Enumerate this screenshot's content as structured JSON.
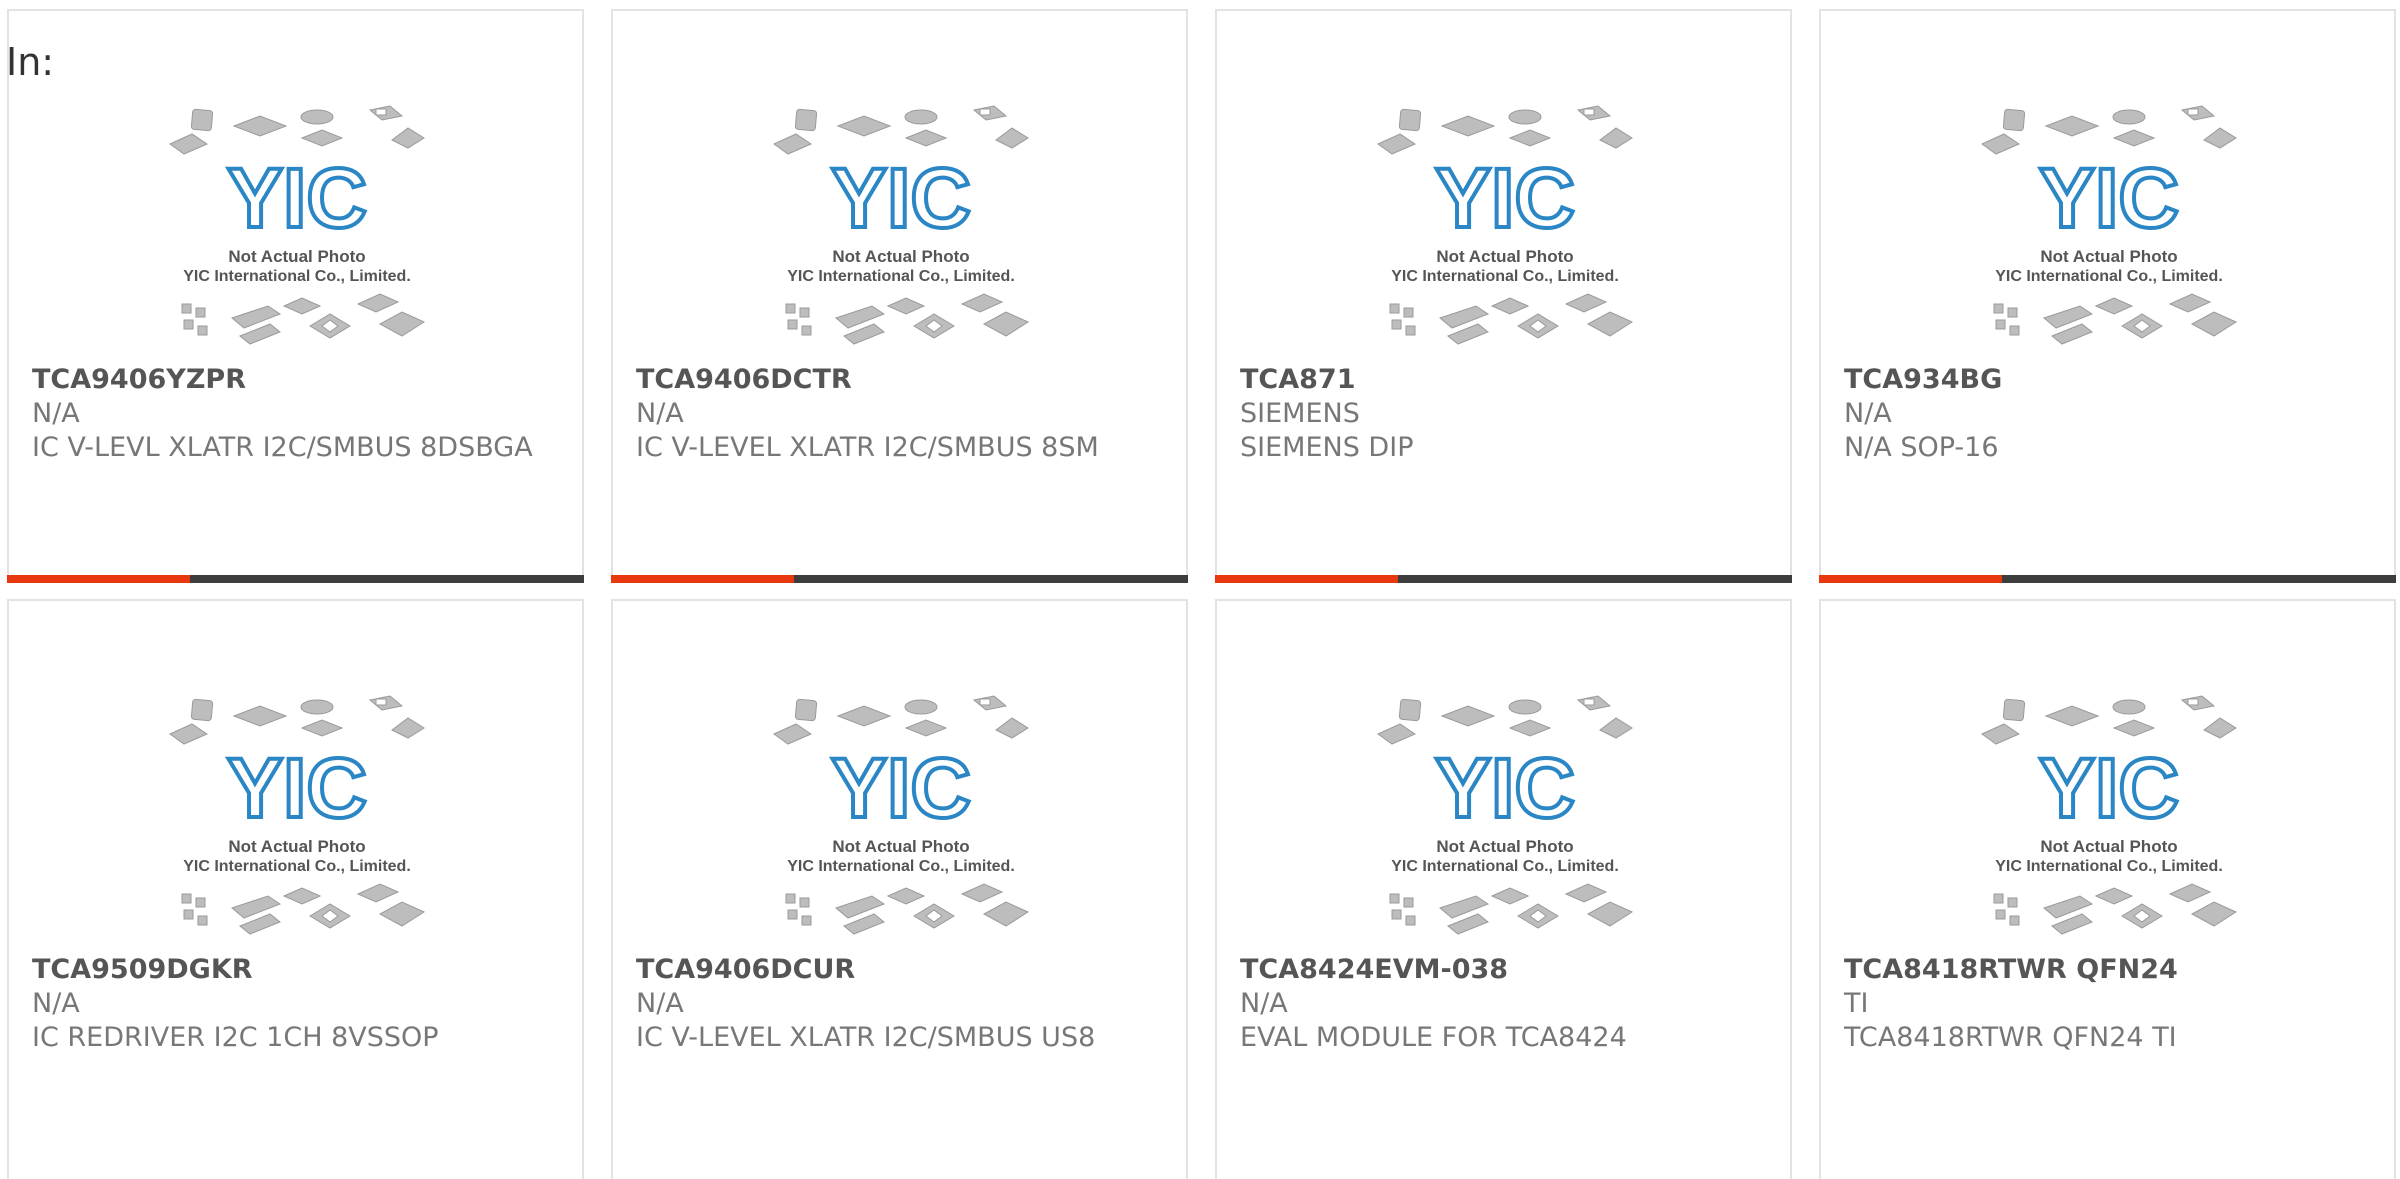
{
  "page": {
    "label": "In:"
  },
  "accent_color": "#e8380d",
  "placeholder": {
    "logo_text": "YIC",
    "caption_line1": "Not Actual Photo",
    "caption_line2": "YIC International Co., Limited.",
    "icon": "chip-packages-icon"
  },
  "products": [
    {
      "part": "TCA9406YZPR",
      "manufacturer": "N/A",
      "description": "IC V-LEVL XLATR I2C/SMBUS 8DSBGA"
    },
    {
      "part": "TCA9406DCTR",
      "manufacturer": "N/A",
      "description": "IC V-LEVEL XLATR I2C/SMBUS 8SM"
    },
    {
      "part": "TCA871",
      "manufacturer": "SIEMENS",
      "description": "SIEMENS DIP"
    },
    {
      "part": "TCA934BG",
      "manufacturer": "N/A",
      "description": "N/A SOP-16"
    },
    {
      "part": "TCA9509DGKR",
      "manufacturer": "N/A",
      "description": "IC REDRIVER I2C 1CH 8VSSOP"
    },
    {
      "part": "TCA9406DCUR",
      "manufacturer": "N/A",
      "description": "IC V-LEVEL XLATR I2C/SMBUS US8"
    },
    {
      "part": "TCA8424EVM-038",
      "manufacturer": "N/A",
      "description": "EVAL MODULE FOR TCA8424"
    },
    {
      "part": "TCA8418RTWR QFN24",
      "manufacturer": "TI",
      "description": "TCA8418RTWR QFN24 TI"
    }
  ]
}
